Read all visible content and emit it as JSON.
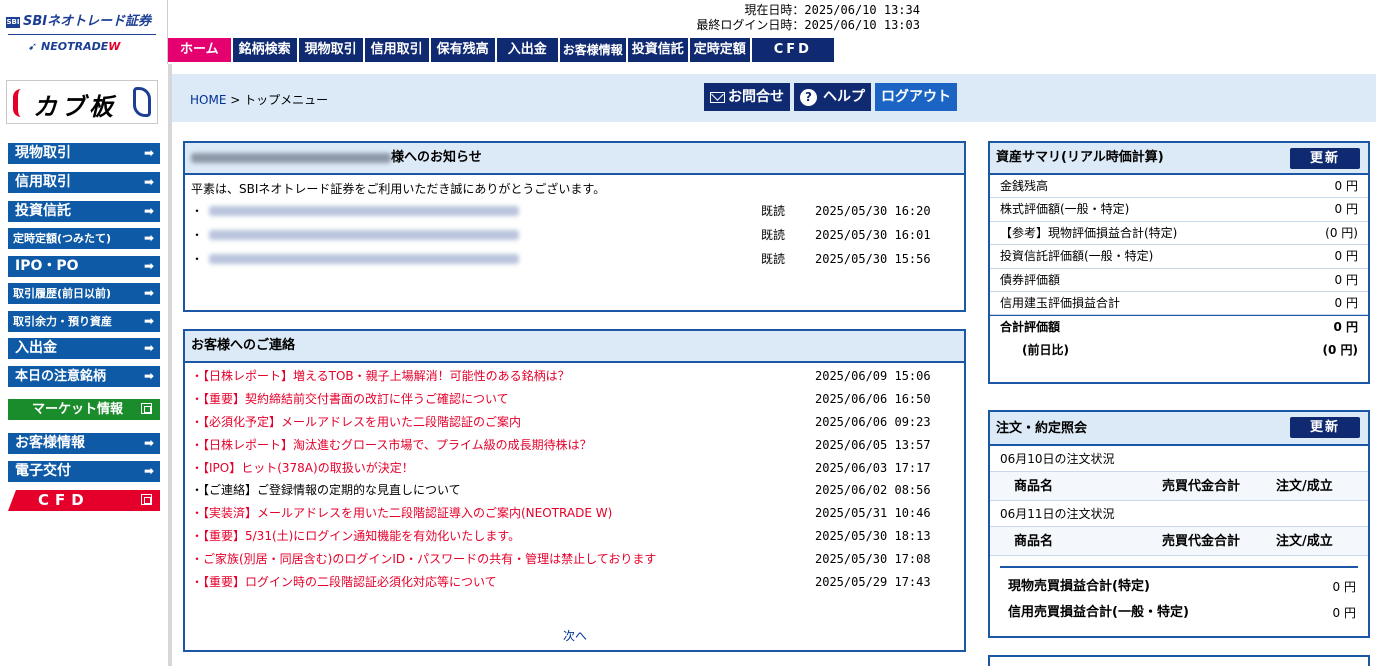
{
  "header": {
    "logo_top": "SBIネオトレード証券",
    "logo_top_mark": "SBI",
    "logo_bottom_a": "NEOTRADE",
    "logo_bottom_b": "W",
    "current_time": "現在日時：2025/06/10 13:34",
    "last_login": "最終ログイン日時：2025/06/10 13:03",
    "nav": [
      "ホーム",
      "銘柄検索",
      "現物取引",
      "信用取引",
      "保有残高",
      "入出金",
      "お客様情報",
      "投資信託",
      "定時定額",
      "CFD"
    ]
  },
  "sidebar": {
    "kabuita": "カブ板",
    "items": [
      "現物取引",
      "信用取引",
      "投資信託",
      "定時定額(つみたて)",
      "IPO・PO",
      "取引履歴(前日以前)",
      "取引余力・預り資産",
      "入出金",
      "本日の注意銘柄",
      "マーケット情報",
      "お客様情報",
      "電子交付",
      "CFD"
    ],
    "arrow": "➡"
  },
  "breadcrumb": {
    "home": "HOME",
    "sep": " > ",
    "current": "トップメニュー"
  },
  "util": {
    "contact": "お問合せ",
    "help": "ヘルプ",
    "help_glyph": "?",
    "logout": "ログアウト"
  },
  "notice": {
    "title_suffix": "様へのお知らせ",
    "intro": "平素は、SBIネオトレード証券をご利用いただき誠にありがとうございます。",
    "rows": [
      {
        "bullet": "・",
        "status": "既読",
        "date": "2025/05/30 16:20"
      },
      {
        "bullet": "・",
        "status": "既読",
        "date": "2025/05/30 16:01"
      },
      {
        "bullet": "・",
        "status": "既読",
        "date": "2025/05/30 15:56"
      }
    ]
  },
  "contact": {
    "title": "お客様へのご連絡",
    "rows": [
      {
        "title": "・【日株レポート】増えるTOB・親子上場解消！可能性のある銘柄は？",
        "date": "2025/06/09 15:06"
      },
      {
        "title": "・【重要】契約締結前交付書面の改訂に伴うご確認について",
        "date": "2025/06/06 16:50"
      },
      {
        "title": "・【必須化予定】メールアドレスを用いた二段階認証のご案内",
        "date": "2025/06/06 09:23"
      },
      {
        "title": "・【日株レポート】淘汰進むグロース市場で、プライム級の成長期待株は？",
        "date": "2025/06/05 13:57"
      },
      {
        "title": "・【IPO】ヒット(378A)の取扱いが決定！",
        "date": "2025/06/03 17:17"
      },
      {
        "title": "・【ご連絡】ご登録情報の定期的な見直しについて",
        "date": "2025/06/02 08:56"
      },
      {
        "title": "・【実装済】メールアドレスを用いた二段階認証導入のご案内(NEOTRADE W)",
        "date": "2025/05/31 10:46"
      },
      {
        "title": "・【重要】5/31(土)にログイン通知機能を有効化いたします。",
        "date": "2025/05/30 18:13"
      },
      {
        "title": "・ご家族(別居・同居含む)のログインID・パスワードの共有・管理は禁止しております",
        "date": "2025/05/30 17:08"
      },
      {
        "title": "・【重要】ログイン時の二段階認証必須化対応等について",
        "date": "2025/05/29 17:43"
      }
    ],
    "next": "次へ"
  },
  "assets": {
    "title": "資産サマリ(リアル時価計算)",
    "refresh": "更新",
    "rows": [
      {
        "label": "金銭残高",
        "value": "0 円"
      },
      {
        "label": "株式評価額(一般・特定)",
        "value": "0 円"
      },
      {
        "label": "【参考】現物評価損益合計(特定)",
        "value": "(0 円)"
      },
      {
        "label": "投資信託評価額(一般・特定)",
        "value": "0 円"
      },
      {
        "label": "債券評価額",
        "value": "0 円"
      },
      {
        "label": "信用建玉評価損益合計",
        "value": "0 円"
      }
    ],
    "total_label": "合計評価額",
    "total_value": "0 円",
    "prev_label": "(前日比)",
    "prev_value": "(0 円)"
  },
  "orders": {
    "title": "注文・約定照会",
    "refresh": "更新",
    "day1": "06月10日の注文状況",
    "day2": "06月11日の注文状況",
    "cols": [
      "商品名",
      "売買代金合計",
      "注文/成立"
    ],
    "pnl": [
      {
        "label": "現物売買損益合計(特定)",
        "value": "0 円"
      },
      {
        "label": "信用売買損益合計(一般・特定)",
        "value": "0 円"
      }
    ]
  }
}
